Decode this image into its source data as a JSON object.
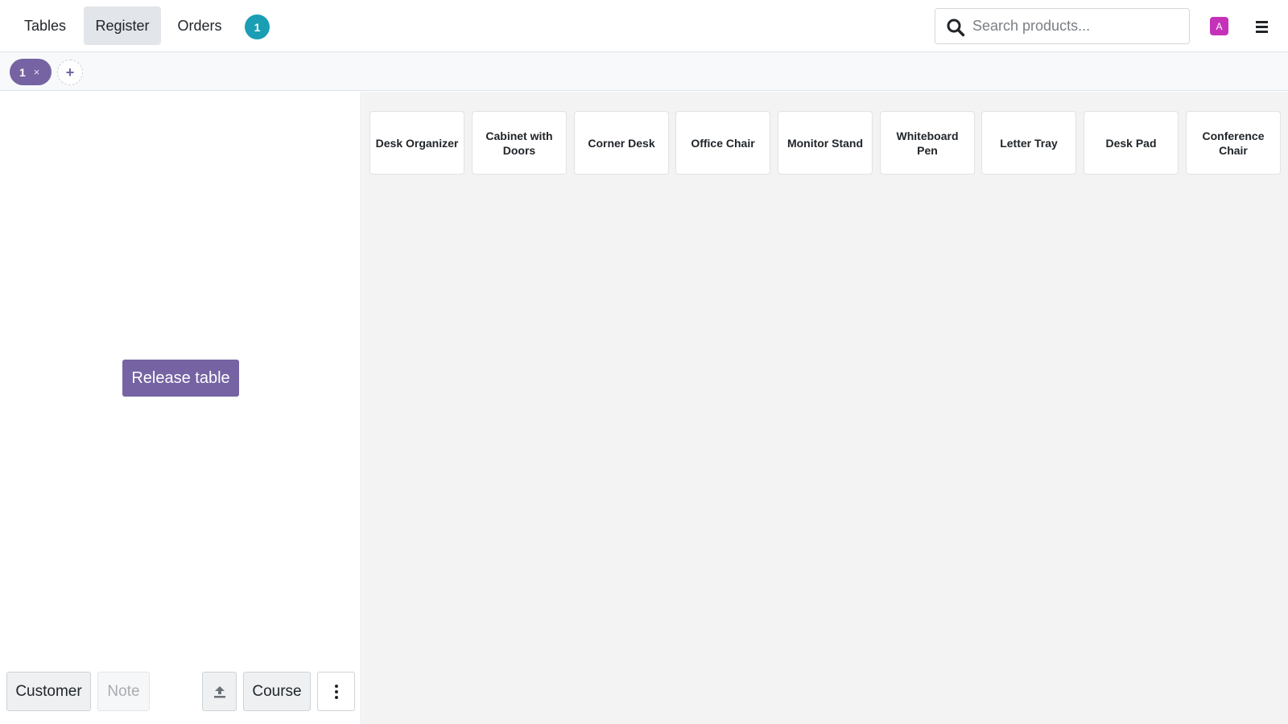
{
  "navbar": {
    "tabs": [
      {
        "label": "Tables",
        "active": false
      },
      {
        "label": "Register",
        "active": true
      },
      {
        "label": "Orders",
        "active": false
      }
    ],
    "orders_badge": "1",
    "search": {
      "placeholder": "Search products...",
      "value": ""
    },
    "user_avatar": "A",
    "icons": {
      "search": "search-icon",
      "menu": "hamburger-menu-icon"
    }
  },
  "order_strip": {
    "orders": [
      {
        "label": "1",
        "close": "×"
      }
    ],
    "add_label": "+"
  },
  "left_panel": {
    "release_table_label": "Release table",
    "buttons": {
      "customer": "Customer",
      "note": "Note",
      "upload_icon": "upload-icon",
      "course": "Course",
      "more_icon": "vertical-dots-icon"
    }
  },
  "products": [
    {
      "name": "Desk Organizer"
    },
    {
      "name": "Cabinet with Doors"
    },
    {
      "name": "Corner Desk"
    },
    {
      "name": "Office Chair"
    },
    {
      "name": "Monitor Stand"
    },
    {
      "name": "Whiteboard Pen"
    },
    {
      "name": "Letter Tray"
    },
    {
      "name": "Desk Pad"
    },
    {
      "name": "Conference Chair"
    }
  ],
  "colors": {
    "primary": "#7563a3",
    "badge": "#1a9eb4",
    "avatar": "#c532b8",
    "product_area_bg": "#f3f3f3"
  }
}
